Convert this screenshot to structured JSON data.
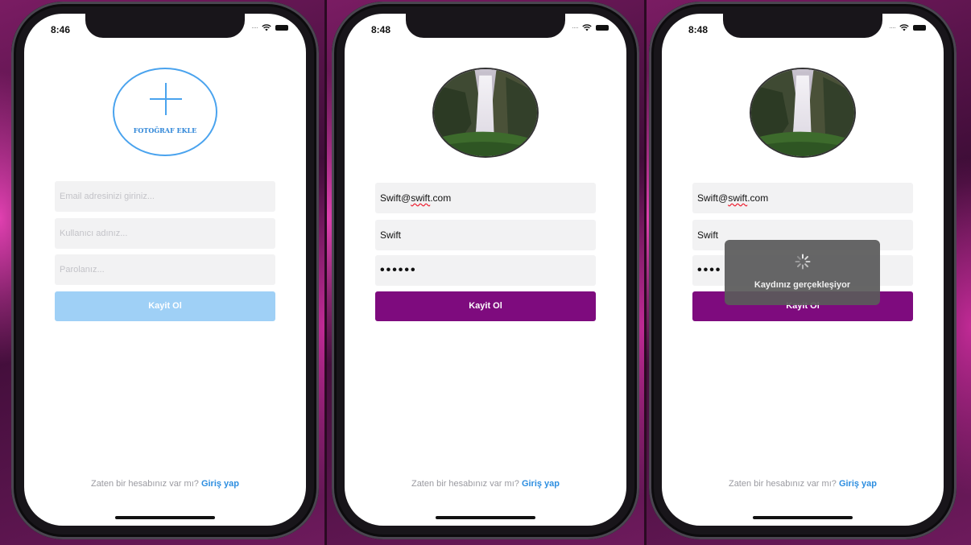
{
  "screens": [
    {
      "time": "8:46",
      "add_photo_label": "FOTOĞRAF EKLE",
      "email": {
        "value": "",
        "placeholder": "Email adresinizi giriniz..."
      },
      "username": {
        "value": "",
        "placeholder": "Kullanıcı adınız..."
      },
      "password": {
        "value": "",
        "placeholder": "Parolanız..."
      },
      "submit_label": "Kayit Ol",
      "submit_state": "disabled",
      "footer_text": "Zaten bir hesabınız var mı?",
      "footer_link": "Giriş yap"
    },
    {
      "time": "8:48",
      "avatar": "waterfall-photo",
      "email_prefix": "Swift@",
      "email_mid": "swift",
      "email_suffix": ".com",
      "username": "Swift",
      "password": "••••••",
      "submit_label": "Kayit Ol",
      "submit_state": "active",
      "footer_text": "Zaten bir hesabınız var mı?",
      "footer_link": "Giriş yap"
    },
    {
      "time": "8:48",
      "avatar": "waterfall-photo",
      "email_prefix": "Swift@",
      "email_mid": "swift",
      "email_suffix": ".com",
      "username": "Swift",
      "password": "••••",
      "submit_label": "Kayit Ol",
      "submit_state": "active",
      "hud_text": "Kaydınız gerçekleşiyor",
      "footer_text": "Zaten bir hesabınız var mı?",
      "footer_link": "Giriş yap"
    }
  ],
  "colors": {
    "accent_blue": "#4aa3ee",
    "button_disabled": "#9fd0f6",
    "button_active": "#7e0b7e",
    "link": "#2d8ee0"
  }
}
